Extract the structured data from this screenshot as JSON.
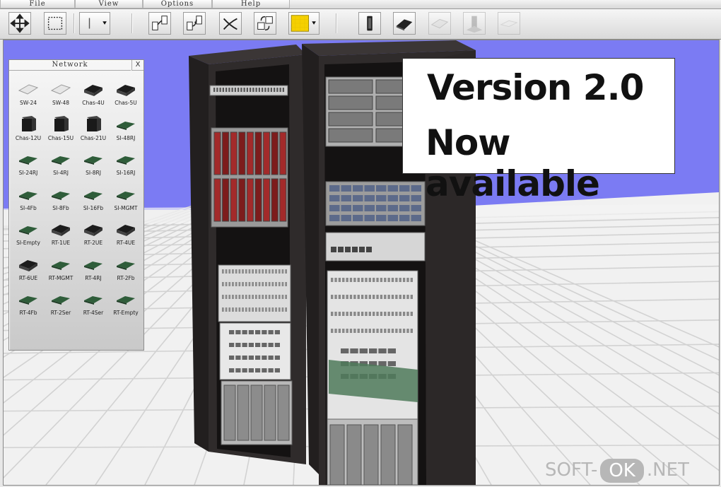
{
  "menu": [
    {
      "id": "file",
      "label": "File"
    },
    {
      "id": "view",
      "label": "View"
    },
    {
      "id": "options",
      "label": "Options"
    },
    {
      "id": "help",
      "label": "Help"
    }
  ],
  "toolbar": {
    "tools": [
      {
        "id": "move",
        "icon": "move-arrows-icon"
      },
      {
        "id": "select",
        "icon": "marquee-select-icon"
      },
      {
        "id": "line",
        "icon": "line-tool-icon"
      },
      {
        "id": "connect-a",
        "icon": "connect-icon"
      },
      {
        "id": "connect-b",
        "icon": "connect-alt-icon"
      },
      {
        "id": "disconnect",
        "icon": "cut-cable-icon"
      },
      {
        "id": "swap",
        "icon": "swap-icon"
      },
      {
        "id": "color",
        "icon": "color-swatch-icon",
        "value": "#f5d000"
      },
      {
        "id": "rack",
        "icon": "rack-icon"
      },
      {
        "id": "chassis",
        "icon": "chassis-icon"
      },
      {
        "id": "switch",
        "icon": "switch-icon"
      },
      {
        "id": "floor",
        "icon": "floor-icon"
      },
      {
        "id": "blank",
        "icon": "blank-panel-icon"
      }
    ]
  },
  "panel": {
    "title": "Network",
    "close_label": "X",
    "items": [
      {
        "label": "SW-24",
        "kind": "switch"
      },
      {
        "label": "SW-48",
        "kind": "switch"
      },
      {
        "label": "Chas-4U",
        "kind": "chassis"
      },
      {
        "label": "Chas-5U",
        "kind": "chassis"
      },
      {
        "label": "Chas-12U",
        "kind": "tall"
      },
      {
        "label": "Chas-15U",
        "kind": "tall"
      },
      {
        "label": "Chas-21U",
        "kind": "tall"
      },
      {
        "label": "SI-48RJ",
        "kind": "card"
      },
      {
        "label": "SI-24RJ",
        "kind": "card"
      },
      {
        "label": "SI-4RJ",
        "kind": "card"
      },
      {
        "label": "SI-8RJ",
        "kind": "card"
      },
      {
        "label": "SI-16RJ",
        "kind": "card"
      },
      {
        "label": "SI-4Fb",
        "kind": "card"
      },
      {
        "label": "SI-8Fb",
        "kind": "card"
      },
      {
        "label": "SI-16Fb",
        "kind": "card"
      },
      {
        "label": "SI-MGMT",
        "kind": "card"
      },
      {
        "label": "SI-Empty",
        "kind": "card"
      },
      {
        "label": "RT-1UE",
        "kind": "chassis"
      },
      {
        "label": "RT-2UE",
        "kind": "chassis"
      },
      {
        "label": "RT-4UE",
        "kind": "chassis"
      },
      {
        "label": "RT-6UE",
        "kind": "chassis"
      },
      {
        "label": "RT-MGMT",
        "kind": "card"
      },
      {
        "label": "RT-4RJ",
        "kind": "card"
      },
      {
        "label": "RT-2Fb",
        "kind": "card"
      },
      {
        "label": "RT-4Fb",
        "kind": "card"
      },
      {
        "label": "RT-2Ser",
        "kind": "card"
      },
      {
        "label": "RT-4Ser",
        "kind": "card"
      },
      {
        "label": "RT-Empty",
        "kind": "card"
      }
    ]
  },
  "banner": {
    "line1": "Version 2.0",
    "line2": "Now available"
  },
  "watermark": {
    "prefix": "SOFT-",
    "middle": "OK",
    "suffix": ".NET"
  },
  "colors": {
    "sky": "#7b7bf3",
    "rack": "#2f2b2b",
    "accent": "#f5d000"
  }
}
